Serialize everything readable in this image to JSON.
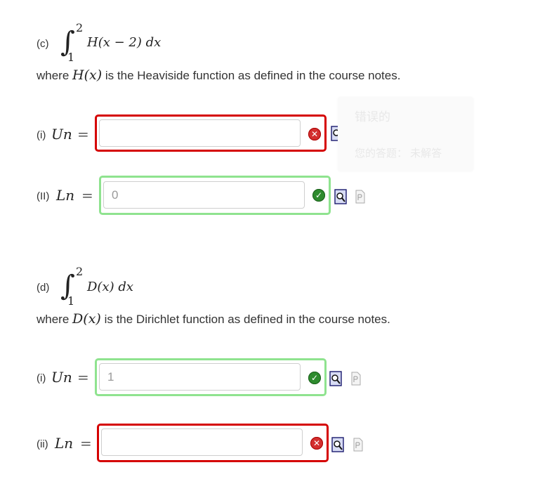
{
  "part_c": {
    "label": "(c)",
    "integral_lower": "1",
    "integral_upper": "2",
    "integrand": "H(x − 2) dx",
    "desc_prefix": "where",
    "desc_func": "H(x)",
    "desc_suffix": "is the Heaviside function as defined in the course notes.",
    "q1": {
      "label": "(i)",
      "var": "Un",
      "eq": "=",
      "value": "",
      "status": "incorrect"
    },
    "q2": {
      "label": "(II)",
      "var": "Ln",
      "eq": "=",
      "value": "0",
      "status": "correct"
    }
  },
  "part_d": {
    "label": "(d)",
    "integral_lower": "1",
    "integral_upper": "2",
    "integrand": "D(x) dx",
    "desc_prefix": "where",
    "desc_func": "D(x)",
    "desc_suffix": "is the Dirichlet function as defined in the course notes.",
    "q1": {
      "label": "(i)",
      "var": "Un",
      "eq": "=",
      "value": "1",
      "status": "correct"
    },
    "q2": {
      "label": "(ii)",
      "var": "Ln",
      "eq": "=",
      "value": "",
      "status": "incorrect"
    }
  },
  "tooltip": {
    "title": "错误的",
    "answer_text": "您的答题： 未解答"
  },
  "colors": {
    "error_border": "#d50000",
    "correct_border": "#8fe38f",
    "error_icon": "#d32f2f",
    "correct_icon": "#2e8b2e"
  },
  "icons": {
    "incorrect": "x-circle-icon",
    "correct": "check-circle-icon",
    "preview": "magnifier-preview-icon",
    "text": "text-document-icon"
  }
}
